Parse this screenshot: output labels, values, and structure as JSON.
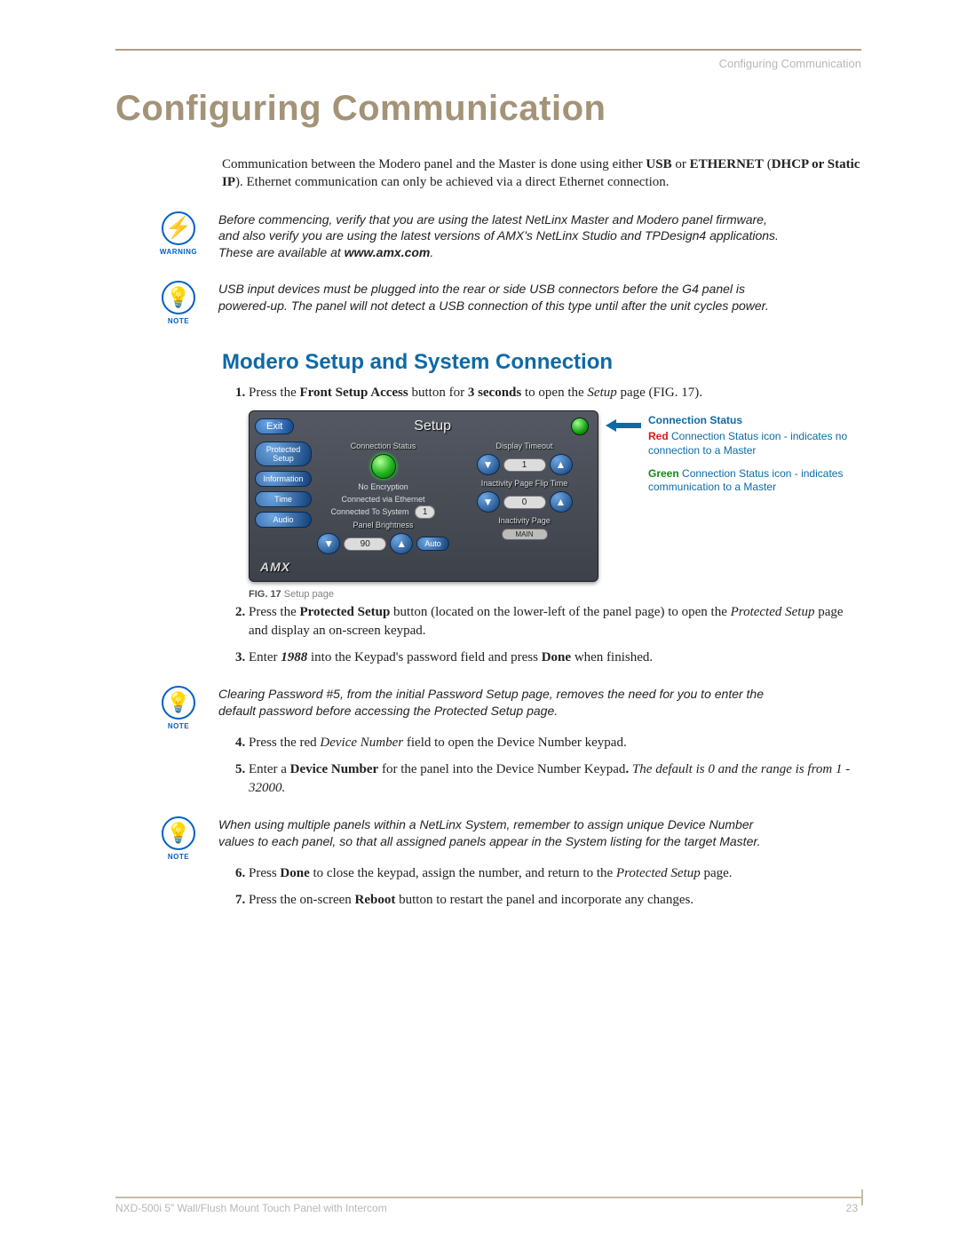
{
  "header": {
    "running_head": "Configuring Communication",
    "title": "Configuring Communication"
  },
  "intro": {
    "pre": "Communication between the Modero panel and the Master is done using either ",
    "usb": "USB",
    "or": " or ",
    "eth": "ETHERNET",
    "paren": " (",
    "dhcp": "DHCP or Static IP",
    "post": "). Ethernet communication can only be achieved via a direct Ethernet connection."
  },
  "warning": {
    "label": "WARNING",
    "text_pre": "Before commencing, verify that you are using the latest NetLinx Master and Modero panel firmware, and also verify you are using the latest versions of AMX's NetLinx Studio and TPDesign4 applications. These are available at ",
    "url": "www.amx.com",
    "text_post": "."
  },
  "note1": {
    "label": "NOTE",
    "text": "USB input devices must be plugged into the rear or side USB connectors before the G4 panel is powered-up. The panel will not detect a USB connection of this type until after the unit cycles power."
  },
  "section1": "Modero Setup and System Connection",
  "step1": {
    "pre": "Press the ",
    "bold1": "Front Setup Access",
    "mid1": " button for ",
    "bold2": "3 seconds",
    "mid2": " to open the ",
    "ital": "Setup",
    "post": " page (FIG. 17)."
  },
  "setup_panel": {
    "exit": "Exit",
    "title": "Setup",
    "side": [
      "Protected Setup",
      "Information",
      "Time",
      "Audio"
    ],
    "conn_status_label": "Connection Status",
    "no_encryption": "No Encryption",
    "connected_via": "Connected via Ethernet",
    "connected_to_pre": "Connected To System",
    "connected_to_val": "1",
    "panel_brightness_label": "Panel Brightness",
    "brightness_val": "90",
    "auto": "Auto",
    "display_timeout_label": "Display Timeout",
    "display_timeout_val": "1",
    "inactivity_flip_label": "Inactivity Page Flip Time",
    "inactivity_flip_val": "0",
    "inactivity_page_label": "Inactivity Page",
    "inactivity_page_val": "MAIN",
    "logo": "AMX"
  },
  "legend": {
    "header": "Connection Status",
    "red": "Red",
    "red_rest": " Connection Status icon - indicates no connection to a Master",
    "green": "Green",
    "green_rest": " Connection Status icon - indicates communication to a Master"
  },
  "fig_caption": {
    "bold": "FIG. 17",
    "rest": "  Setup page"
  },
  "step2": {
    "pre": "Press the ",
    "bold": "Protected Setup",
    "mid": " button (located on the lower-left of the panel page) to open the ",
    "ital": "Protected Setup",
    "post": " page and display an on-screen keypad."
  },
  "step3": {
    "pre": "Enter ",
    "ital": "1988",
    "mid": " into the Keypad's password field and press ",
    "bold": "Done",
    "post": " when finished."
  },
  "note2": {
    "label": "NOTE",
    "text": "Clearing Password #5, from the initial Password Setup page, removes the need for you to enter the default password before accessing the Protected Setup page."
  },
  "step4": {
    "pre": "Press the red ",
    "ital": "Device Number",
    "post": " field to open the Device Number keypad."
  },
  "step5": {
    "pre": "Enter a ",
    "bold": "Device Number",
    "mid": " for the panel into the Device Number Keypad",
    "dot": ".",
    "ital": " The default is 0 and the range is from 1 - 32000."
  },
  "note3": {
    "label": "NOTE",
    "text": "When using multiple panels within a NetLinx System, remember to assign unique Device Number values to each panel, so that all assigned panels appear in the System listing for the target Master."
  },
  "step6": {
    "pre": "Press ",
    "bold": "Done",
    "mid": " to close the keypad, assign the number, and return to the ",
    "ital": "Protected Setup",
    "post": " page."
  },
  "step7": {
    "pre": "Press the on-screen ",
    "bold": "Reboot",
    "post": " button to restart the panel and incorporate any changes."
  },
  "footer": {
    "text": "NXD-500i 5\" Wall/Flush Mount Touch Panel with Intercom",
    "page": "23"
  }
}
